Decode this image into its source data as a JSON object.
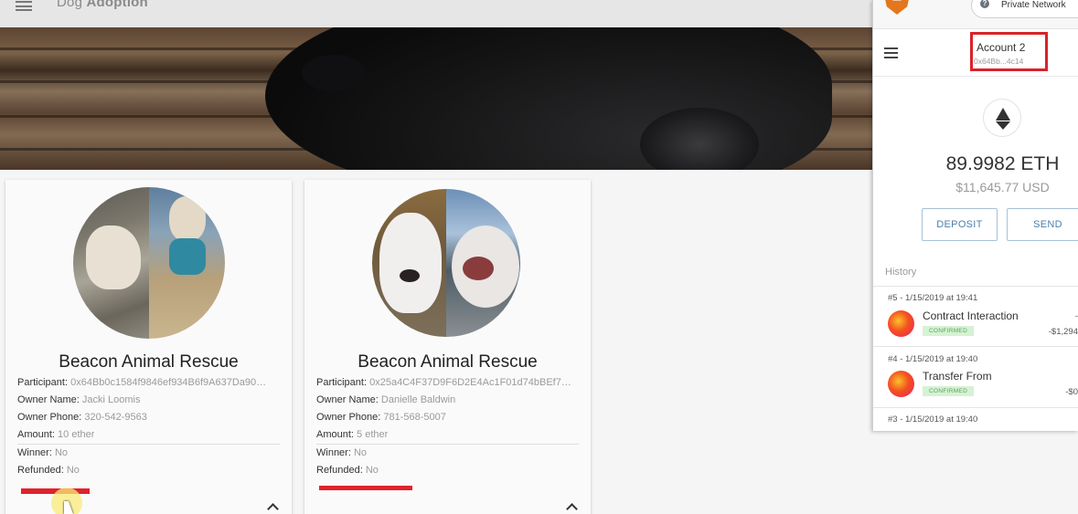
{
  "appbar": {
    "title_light": "Dog",
    "title_bold": "Adoption"
  },
  "cards": [
    {
      "title": "Beacon Animal Rescue",
      "participant_label": "Participant:",
      "participant": "0x64Bb0c1584f9846ef934B6f9A637Da90…",
      "owner_name_label": "Owner Name:",
      "owner_name": "Jacki Loomis",
      "owner_phone_label": "Owner Phone:",
      "owner_phone": "320-542-9563",
      "amount_label": "Amount:",
      "amount": "10 ether",
      "winner_label": "Winner:",
      "winner": "No",
      "refunded_label": "Refunded:",
      "refunded": "No"
    },
    {
      "title": "Beacon Animal Rescue",
      "participant_label": "Participant:",
      "participant": "0x25a4C4F37D9F6D2E4Ac1F01d74bBEf7…",
      "owner_name_label": "Owner Name:",
      "owner_name": "Danielle Baldwin",
      "owner_phone_label": "Owner Phone:",
      "owner_phone": "781-568-5007",
      "amount_label": "Amount:",
      "amount": "5 ether",
      "winner_label": "Winner:",
      "winner": "No",
      "refunded_label": "Refunded:",
      "refunded": "No"
    }
  ],
  "metamask": {
    "network": "Private Network",
    "account_name": "Account 2",
    "account_address": "0x64Bb...4c14",
    "balance": "89.9982 ETH",
    "balance_usd": "$11,645.77 USD",
    "deposit_label": "DEPOSIT",
    "send_label": "SEND",
    "history_label": "History",
    "transactions": [
      {
        "date": "#5 - 1/15/2019 at 19:41",
        "name": "Contract Interaction",
        "status": "CONFIRMED",
        "amount_top": "-",
        "amount": "-$1,294"
      },
      {
        "date": "#4 - 1/15/2019 at 19:40",
        "name": "Transfer From",
        "status": "CONFIRMED",
        "amount": "-$0"
      },
      {
        "date": "#3 - 1/15/2019 at 19:40"
      }
    ]
  },
  "colors": {
    "highlight_red": "#d8232a",
    "accent_blue": "#4a7fae",
    "confirmed_green": "#5aa35a"
  }
}
